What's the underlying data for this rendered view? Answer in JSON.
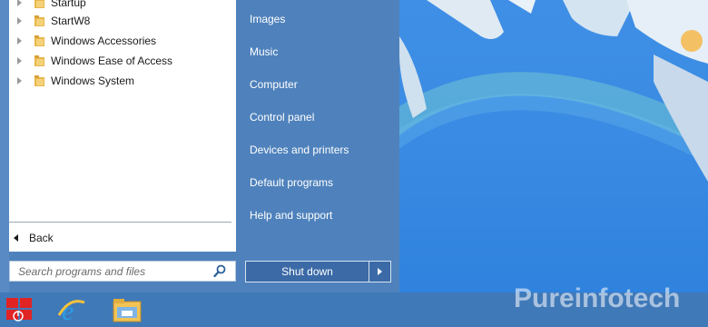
{
  "programs": {
    "items": [
      {
        "label": "Startup"
      },
      {
        "label": "StartW8"
      },
      {
        "label": "Windows Accessories"
      },
      {
        "label": "Windows Ease of Access"
      },
      {
        "label": "Windows System"
      }
    ],
    "back_label": "Back"
  },
  "search": {
    "placeholder": "Search programs and files",
    "icon": "search-icon"
  },
  "right_panel": {
    "items": [
      {
        "label": "Images"
      },
      {
        "label": "Music"
      },
      {
        "label": "Computer"
      },
      {
        "label": "Control panel"
      },
      {
        "label": "Devices and printers"
      },
      {
        "label": "Default programs"
      },
      {
        "label": "Help and support"
      }
    ]
  },
  "shutdown": {
    "label": "Shut down"
  },
  "taskbar": {
    "apps": [
      {
        "name": "start-icon"
      },
      {
        "name": "internet-explorer-icon"
      },
      {
        "name": "file-explorer-icon"
      }
    ]
  },
  "watermark": {
    "text": "Pureinfotech"
  },
  "colors": {
    "menu_blue": "#4f82bc",
    "desktop_blue": "#3a8be3",
    "taskbar": "#4079b8",
    "start_red": "#e02424"
  }
}
